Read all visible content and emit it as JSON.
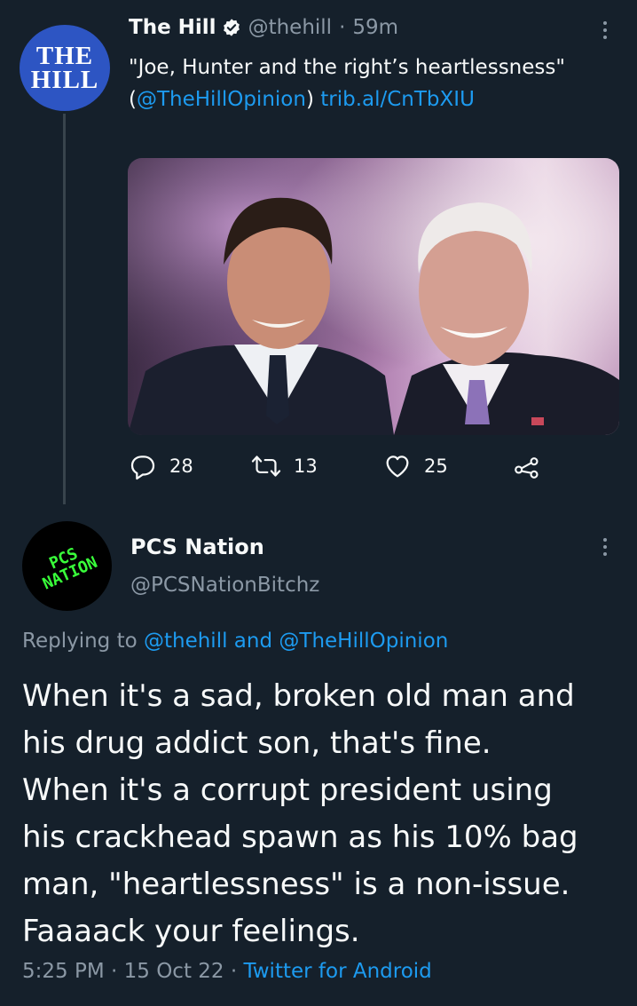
{
  "top_tweet": {
    "avatar_text": [
      "THE",
      "HILL"
    ],
    "name": "The Hill",
    "handle": "@thehill",
    "separator": "·",
    "time": "59m",
    "text_plain_1": "\"Joe, Hunter and the right’s heartlessness\" (",
    "text_mention": "@TheHillOpinion",
    "text_plain_2": ") ",
    "text_link": "trib.al/CnTbXIU",
    "stats": {
      "replies": "28",
      "retweets": "13",
      "likes": "25"
    },
    "icons": [
      "verified-badge-icon",
      "more-icon",
      "reply-icon",
      "retweet-icon",
      "like-icon",
      "share-icon"
    ]
  },
  "reply_tweet": {
    "avatar_text": [
      "PCS",
      "NATION"
    ],
    "name": "PCS Nation",
    "handle": "@PCSNationBitchz",
    "replying_prefix": "Replying to ",
    "replying_to_1": "@thehill",
    "replying_and": " and ",
    "replying_to_2": "@TheHillOpinion",
    "body": "When it's a sad, broken old man and\nhis drug addict son, that's fine.\nWhen it's a corrupt president using\nhis crackhead spawn as his 10% bag\nman, \"heartlessness\" is a non-issue.\nFaaaack your feelings.",
    "time": "5:25 PM",
    "date": "15 Oct 22",
    "source": "Twitter for Android",
    "meta_separator": " · "
  },
  "colors": {
    "background": "#15202b",
    "text": "#f7f9f9",
    "muted": "#8b98a5",
    "link": "#1d9bf0",
    "hill_blue": "#2d55c3",
    "pcs_green": "#39ff3a"
  }
}
